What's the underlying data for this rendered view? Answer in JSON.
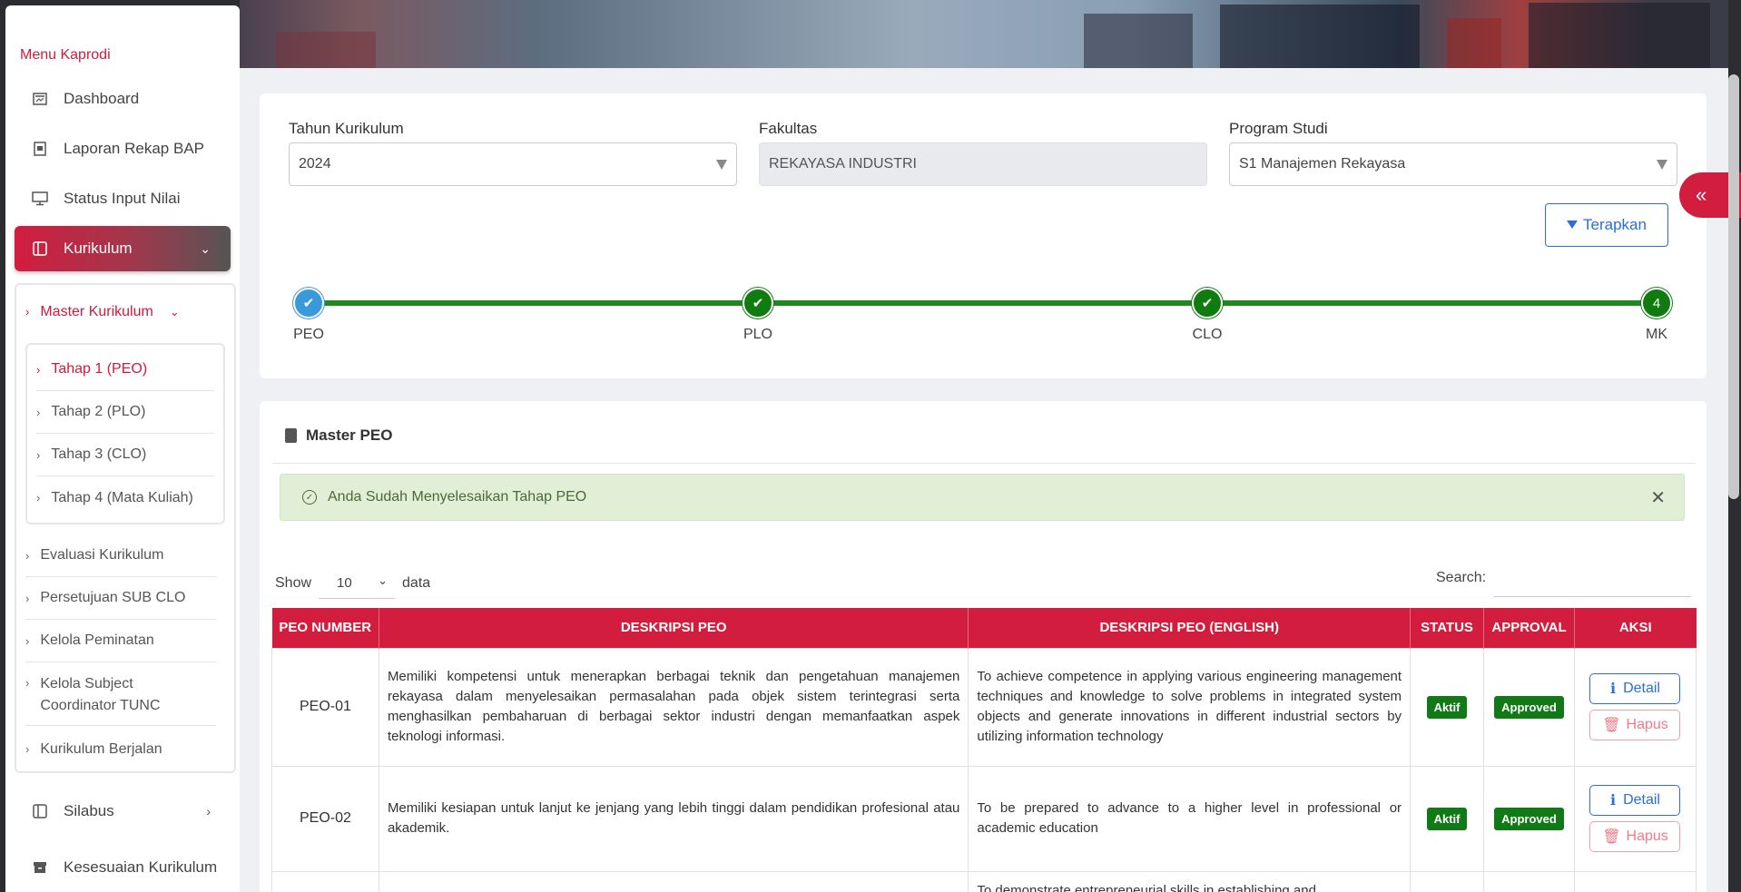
{
  "sidebar": {
    "menu_title": "Menu Kaprodi",
    "items": [
      {
        "label": "Dashboard"
      },
      {
        "label": "Laporan Rekap BAP"
      },
      {
        "label": "Status Input Nilai"
      },
      {
        "label": "Kurikulum"
      },
      {
        "label": "Silabus"
      },
      {
        "label": "Kesesuaian Kurikulum"
      }
    ],
    "sub_items": [
      {
        "label": "Master Kurikulum"
      },
      {
        "label": "Evaluasi Kurikulum"
      },
      {
        "label": "Persetujuan SUB CLO"
      },
      {
        "label": "Kelola Peminatan"
      },
      {
        "label": "Kelola Subject Coordinator TUNC"
      },
      {
        "label": "Kurikulum Berjalan"
      }
    ],
    "inner_items": [
      {
        "label": "Tahap 1 (PEO)"
      },
      {
        "label": "Tahap 2 (PLO)"
      },
      {
        "label": "Tahap 3 (CLO)"
      },
      {
        "label": "Tahap 4 (Mata Kuliah)"
      }
    ]
  },
  "filters": {
    "tahun_label": "Tahun Kurikulum",
    "tahun_value": "2024",
    "fakultas_label": "Fakultas",
    "fakultas_value": "REKAYASA INDUSTRI",
    "prodi_label": "Program Studi",
    "prodi_value": "S1 Manajemen Rekayasa",
    "apply_label": "Terapkan"
  },
  "stepper": [
    {
      "label": "PEO"
    },
    {
      "label": "PLO"
    },
    {
      "label": "CLO"
    },
    {
      "label": "MK",
      "number": "4"
    }
  ],
  "section": {
    "title": "Master PEO",
    "alert": "Anda Sudah Menyelesaikan Tahap PEO"
  },
  "table_controls": {
    "show_label": "Show",
    "show_value": "10",
    "data_label": "data",
    "search_label": "Search:"
  },
  "table": {
    "headers": [
      "PEO NUMBER",
      "DESKRIPSI PEO",
      "DESKRIPSI PEO (ENGLISH)",
      "STATUS",
      "APPROVAL",
      "AKSI"
    ],
    "rows": [
      {
        "number": "PEO-01",
        "desc": "Memiliki kompetensi untuk menerapkan berbagai teknik dan pengetahuan manajemen rekayasa dalam menyelesaikan permasalahan pada objek sistem terintegrasi serta menghasilkan pembaharuan di berbagai sektor industri dengan memanfaatkan aspek teknologi informasi.",
        "desc_en": "To achieve competence in applying various engineering management techniques and knowledge to solve problems in integrated system objects and generate innovations in different industrial sectors by utilizing information technology",
        "status": "Aktif",
        "approval": "Approved"
      },
      {
        "number": "PEO-02",
        "desc": "Memiliki kesiapan untuk lanjut ke jenjang yang lebih tinggi dalam pendidikan profesional atau akademik.",
        "desc_en": "To be prepared to advance to a higher level in professional or academic education",
        "status": "Aktif",
        "approval": "Approved"
      },
      {
        "number": "",
        "desc": "",
        "desc_en": "To demonstrate entrepreneurial skills in establishing and",
        "status": "",
        "approval": ""
      }
    ],
    "detail_label": "Detail",
    "hapus_label": "Hapus"
  },
  "colors": {
    "brand_red": "#d31d3f",
    "success_green": "#117a17",
    "link_blue": "#2a6fd6"
  }
}
